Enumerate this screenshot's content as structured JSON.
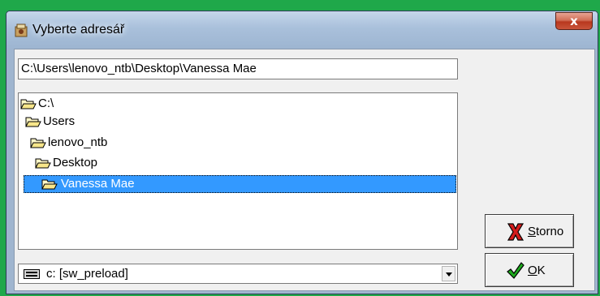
{
  "window": {
    "title": "Vyberte adresář",
    "close_glyph": "x"
  },
  "path_field": {
    "value": "C:\\Users\\lenovo_ntb\\Desktop\\Vanessa Mae"
  },
  "tree": {
    "items": [
      {
        "label": "C:\\",
        "icon": "folder-open-icon"
      },
      {
        "label": "Users",
        "icon": "folder-open-icon"
      },
      {
        "label": "lenovo_ntb",
        "icon": "folder-open-icon"
      },
      {
        "label": "Desktop",
        "icon": "folder-open-icon"
      },
      {
        "label": "Vanessa Mae",
        "icon": "folder-open-icon",
        "selected": true
      }
    ]
  },
  "drive_select": {
    "value": "c: [sw_preload]",
    "icon": "drive-icon"
  },
  "buttons": {
    "storno": {
      "label_underlined": "S",
      "label_rest": "torno",
      "icon": "red-x-icon"
    },
    "ok": {
      "label_underlined": "O",
      "label_rest": "K",
      "icon": "green-check-icon"
    }
  },
  "colors": {
    "selection": "#3399ff",
    "background": "#1fa84a",
    "close_button": "#c9543a"
  }
}
